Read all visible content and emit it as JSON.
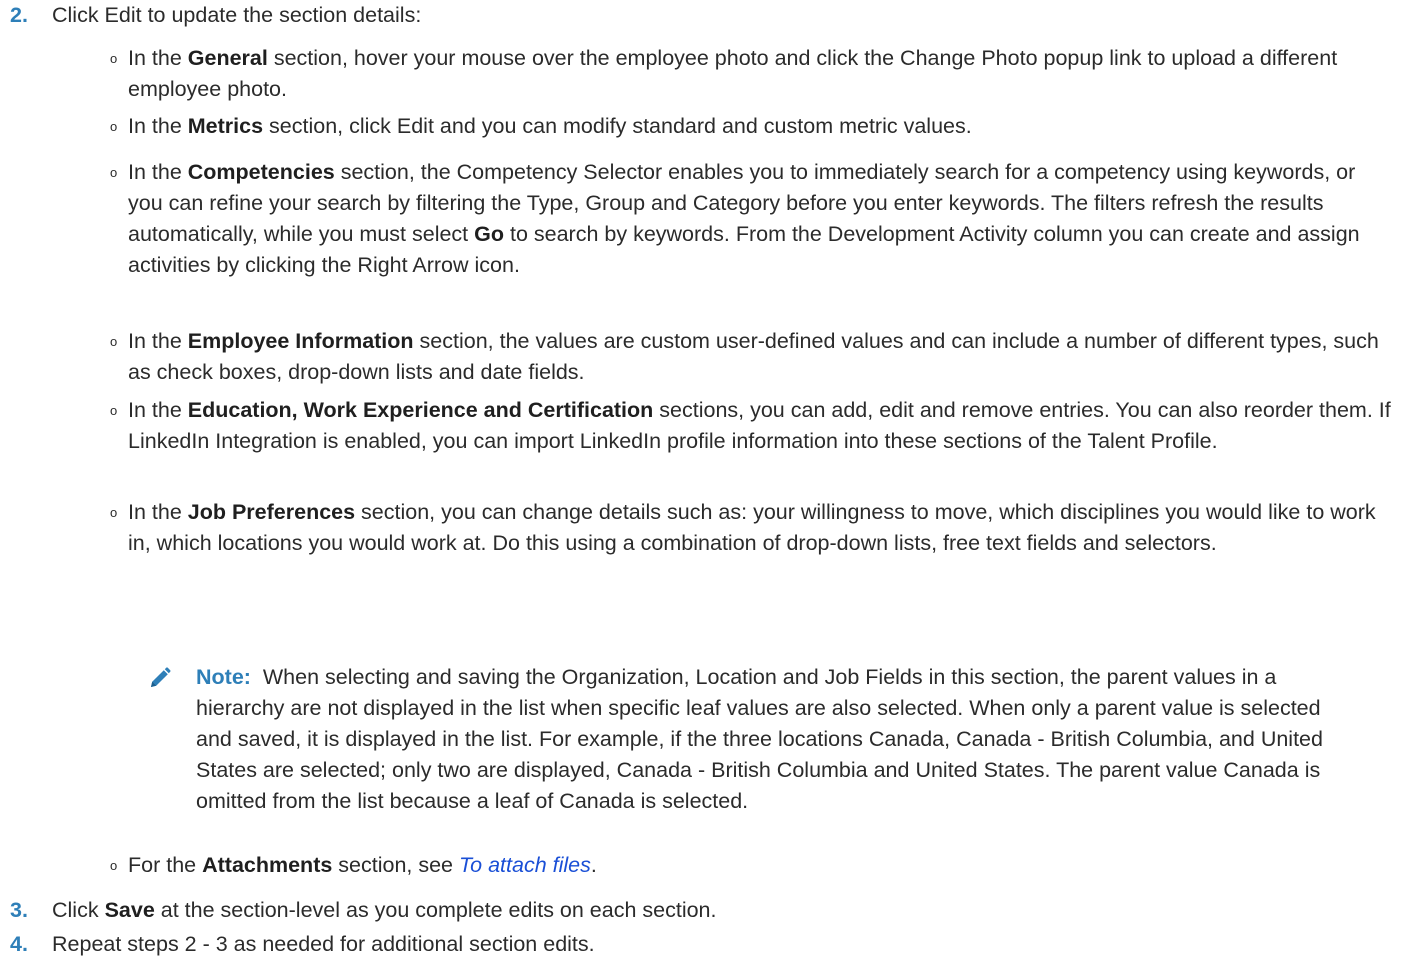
{
  "step2": {
    "number": "2.",
    "text": "Click Edit to update the section details:"
  },
  "subitems": [
    {
      "pre": "In the ",
      "bold": "General",
      "post": " section, hover your mouse over the employee photo and click the Change Photo popup link to upload a different employee photo."
    },
    {
      "pre": "In the ",
      "bold": "Metrics",
      "post": " section, click Edit and you can modify standard and custom metric values."
    },
    {
      "pre": "In the ",
      "bold": "Competencies",
      "post": " section, the Competency Selector enables you to immediately search for a competency using keywords, or you can refine your search by filtering the Type, Group and Category before you enter keywords. The filters refresh the results automatically, while you must select ",
      "bold2": "Go",
      "post2": " to search by keywords. From the Development Activity column you can create and assign activities by clicking the Right Arrow icon."
    },
    {
      "pre": "In the ",
      "bold": "Employee Information",
      "post": " section, the values are custom user-defined values and can include a number of different types, such as check boxes, drop-down lists and date fields."
    },
    {
      "pre": "In the ",
      "bold": "Education, Work Experience and Certification",
      "post": " sections, you can add, edit and remove entries. You can also reorder them. If LinkedIn Integration is enabled, you can import LinkedIn profile information into these sections of the Talent Profile."
    },
    {
      "pre": "In the ",
      "bold": "Job Preferences",
      "post": " section, you can change details such as: your willingness to move, which disciplines you would like to work in, which locations you would work at. Do this using a combination of drop-down lists, free text fields and selectors."
    }
  ],
  "note": {
    "label": "Note:",
    "text": "When selecting and saving the Organization, Location and Job Fields in this section, the parent values in a hierarchy are not displayed in the list when specific leaf values are also selected. When only a parent value is selected and saved, it is displayed in the list. For example, if the three locations Canada, Canada - British Columbia, and United States are selected; only two are displayed, Canada - British Columbia and United States. The parent value Canada is omitted from the list because a leaf of Canada is selected."
  },
  "attachments": {
    "pre": "For the ",
    "bold": "Attachments",
    "mid": " section, see ",
    "link": "To attach files",
    "post": "."
  },
  "step3": {
    "number": "3.",
    "pre": "Click ",
    "bold": "Save",
    "post": " at the section-level as you complete edits on each section."
  },
  "step4": {
    "number": "4.",
    "text": "Repeat steps 2 - 3 as needed for additional section edits."
  },
  "colors": {
    "step_number": "#2e7fb8",
    "note_label": "#2e7fb8",
    "link": "#1a4fd6",
    "body_text": "#2b2b2b"
  },
  "icons": {
    "bullet": "small-circle-bullet",
    "note": "pencil-icon"
  }
}
